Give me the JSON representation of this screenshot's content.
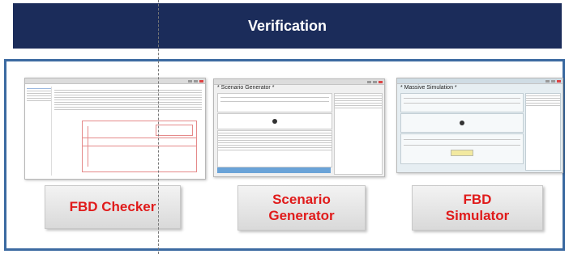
{
  "header": {
    "title": "Verification"
  },
  "tools": [
    {
      "label": "FBD Checker"
    },
    {
      "label": "Scenario\nGenerator",
      "window_title": "* Scenario Generator *"
    },
    {
      "label": "FBD\nSimulator",
      "window_title": "* Massive Simulation *"
    }
  ],
  "colors": {
    "banner": "#1b2c5a",
    "frame": "#3c6aa1",
    "label_text": "#e01b1b"
  }
}
